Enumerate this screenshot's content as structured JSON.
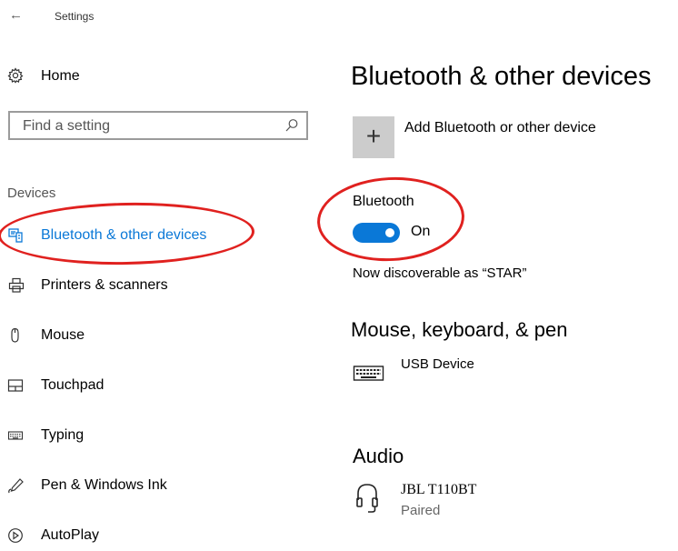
{
  "titlebar": {
    "back_glyph": "←",
    "title": "Settings"
  },
  "sidebar": {
    "home_label": "Home",
    "home_icon": "gear-icon",
    "search": {
      "placeholder": "Find a setting",
      "icon": "search-icon"
    },
    "section_label": "Devices",
    "items": [
      {
        "label": "Bluetooth & other devices",
        "icon": "bluetooth-devices-icon",
        "active": true
      },
      {
        "label": "Printers & scanners",
        "icon": "printer-icon"
      },
      {
        "label": "Mouse",
        "icon": "mouse-icon"
      },
      {
        "label": "Touchpad",
        "icon": "touchpad-icon"
      },
      {
        "label": "Typing",
        "icon": "keyboard-icon"
      },
      {
        "label": "Pen & Windows Ink",
        "icon": "pen-icon"
      },
      {
        "label": "AutoPlay",
        "icon": "autoplay-icon"
      }
    ]
  },
  "main": {
    "title": "Bluetooth & other devices",
    "add_device": {
      "glyph": "+",
      "label": "Add Bluetooth or other device"
    },
    "bluetooth": {
      "label": "Bluetooth",
      "state": "On",
      "enabled": true
    },
    "discoverable_text": "Now discoverable as “STAR”",
    "mouse_keyboard_section": {
      "title": "Mouse, keyboard, & pen",
      "devices": [
        {
          "name": "USB Device",
          "icon": "keyboard-icon"
        }
      ]
    },
    "audio_section": {
      "title": "Audio",
      "devices": [
        {
          "name": "JBL T110BT",
          "status": "Paired",
          "icon": "headphones-icon"
        }
      ]
    }
  },
  "colors": {
    "accent": "#0a78d7",
    "annotation_ring": "#e0211f",
    "add_button_bg": "#cccccc"
  }
}
